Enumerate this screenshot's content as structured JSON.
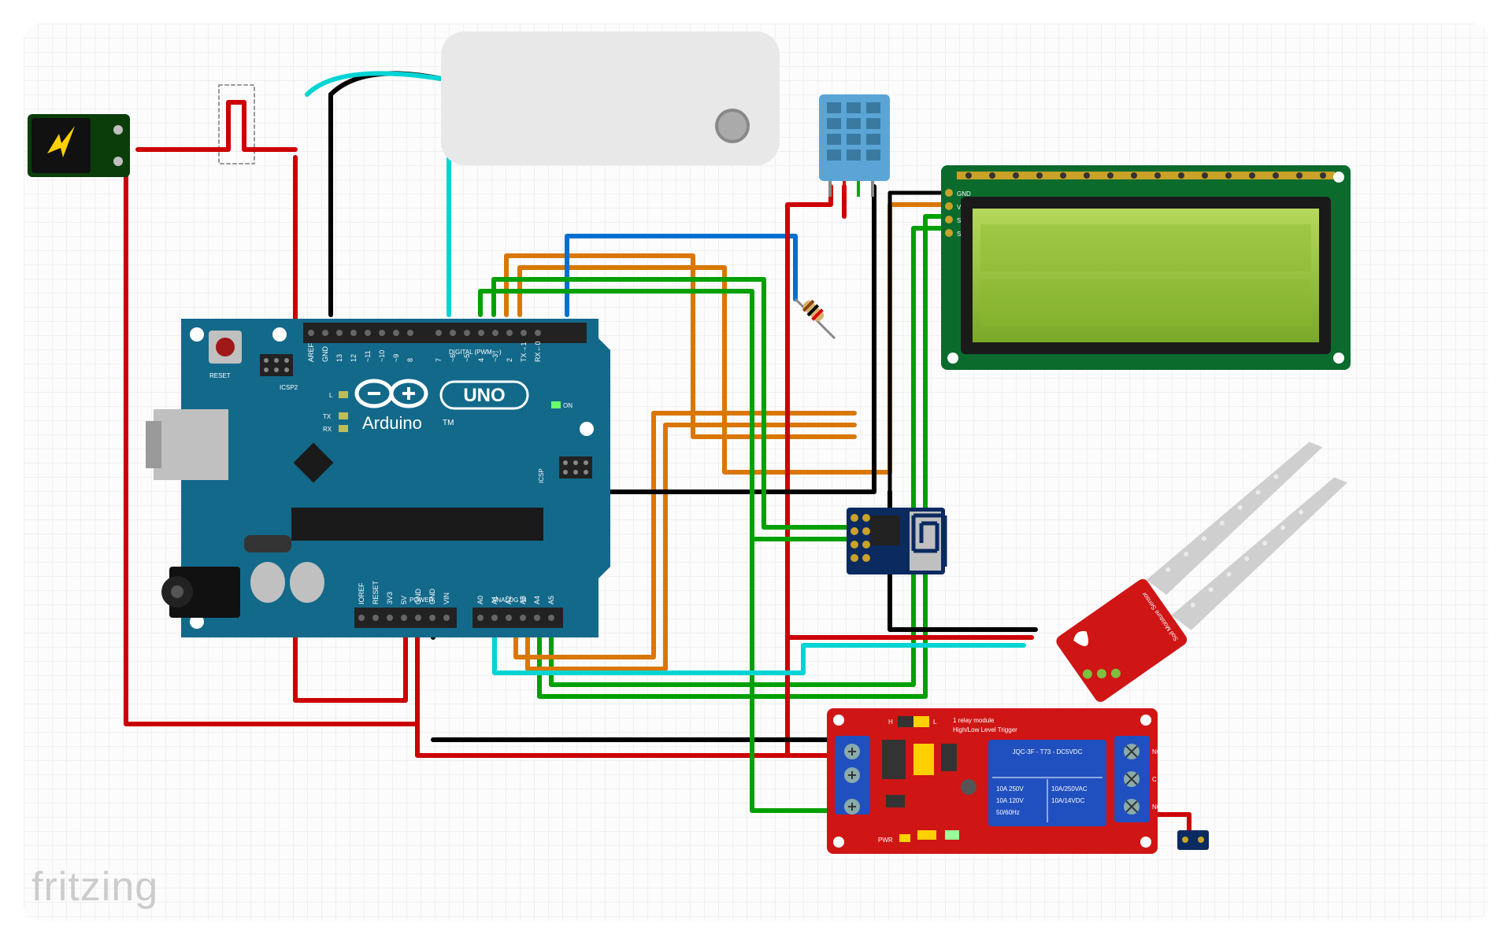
{
  "watermark": "fritzing",
  "arduino": {
    "brand": "Arduino",
    "model": "UNO",
    "reset": "RESET",
    "icsp2": "ICSP2",
    "icsp": "ICSP",
    "digital_header": "DIGITAL (PWM=~)",
    "power_header": "POWER",
    "analog_header": "ANALOG IN",
    "tx": "TX",
    "rx": "RX",
    "on": "ON",
    "l": "L",
    "digital_pins": [
      "AREF",
      "GND",
      "13",
      "12",
      "~11",
      "~10",
      "~9",
      "8",
      "7",
      "~6",
      "~5",
      "4",
      "~3",
      "2",
      "TX→1",
      "RX←0"
    ],
    "power_pins": [
      "IOREF",
      "RESET",
      "3V3",
      "5V",
      "GND",
      "GND",
      "VIN"
    ],
    "analog_pins": [
      "A0",
      "A1",
      "A2",
      "A3",
      "A4",
      "A5"
    ]
  },
  "lcd": {
    "pins": [
      "GND",
      "VCC",
      "SDA",
      "SCL"
    ]
  },
  "relay": {
    "title1": "1 relay module",
    "title2": "High/Low Level Trigger",
    "label": "JQC-3F - T73 - DC5VDC",
    "spec1": "10A 250V",
    "spec2": "10A 120V",
    "spec3": "50/60Hz",
    "spec4": "10A/250VAC",
    "spec5": "10A/14VDC",
    "hl": [
      "H",
      "L"
    ],
    "pwr": "PWR",
    "out": [
      "NC",
      "C M",
      "NO"
    ]
  },
  "soil": {
    "label": "Soil Moisture Sensor"
  },
  "components": {
    "power_jack": "DC Power",
    "power_bank": "Power Bank",
    "dht11": "DHT11",
    "esp8266": "ESP-01",
    "resistor": "Resistor",
    "pump": "Pump"
  }
}
